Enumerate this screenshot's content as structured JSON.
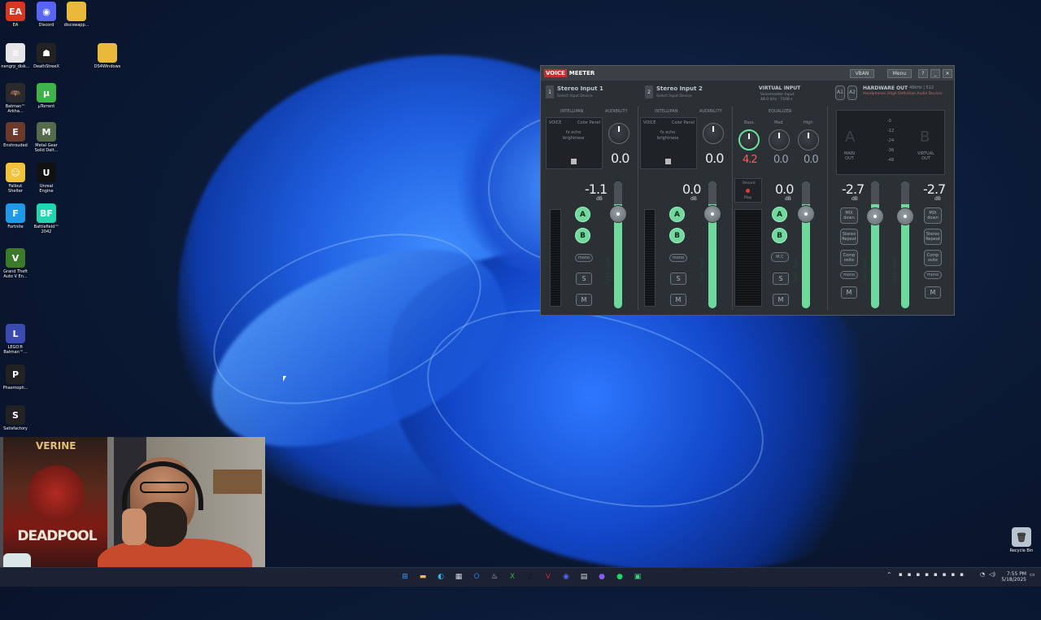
{
  "desktop": {
    "icons": [
      {
        "label": "EA",
        "icon": "ea-icon",
        "color": "#d9361f",
        "glyph": "EA"
      },
      {
        "label": "Discord",
        "icon": "discord-icon",
        "color": "#5865f2",
        "glyph": "◉"
      },
      {
        "label": "discswapp...",
        "icon": "folder-icon",
        "color": "#e8b93a",
        "glyph": ""
      },
      {
        "label": "nengrp_disk...",
        "icon": "file-icon",
        "color": "#e6e6e6",
        "glyph": "≡"
      },
      {
        "label": "DeathStreeX",
        "icon": "game-icon",
        "color": "#222",
        "glyph": "☗"
      },
      {
        "label": "DS4Windows",
        "icon": "folder-icon",
        "color": "#e8b93a",
        "glyph": ""
      },
      {
        "label": "Batman™\nArkha...",
        "icon": "game-icon",
        "color": "#2a2a2a",
        "glyph": "🦇"
      },
      {
        "label": "µTorrent",
        "icon": "utorrent-icon",
        "color": "#3db34a",
        "glyph": "µ"
      },
      {
        "label": "Enshrouded",
        "icon": "game-icon",
        "color": "#6b3a2a",
        "glyph": "E"
      },
      {
        "label": "Metal Gear\nSolid Delt...",
        "icon": "game-icon",
        "color": "#556b4a",
        "glyph": "M"
      },
      {
        "label": "Fallout\nShelter",
        "icon": "game-icon",
        "color": "#f2c23a",
        "glyph": "☺"
      },
      {
        "label": "Unreal\nEngine",
        "icon": "unreal-icon",
        "color": "#111",
        "glyph": "U"
      },
      {
        "label": "Fortnite",
        "icon": "game-icon",
        "color": "#1e9be8",
        "glyph": "F"
      },
      {
        "label": "Battlefield™\n2042",
        "icon": "game-icon",
        "color": "#1fd6b0",
        "glyph": "BF"
      },
      {
        "label": "Grand Theft\nAuto V En...",
        "icon": "game-icon",
        "color": "#3a7a2a",
        "glyph": "V"
      },
      {
        "label": "LEGO®\nBatman™...",
        "icon": "game-icon",
        "color": "#3a4ab0",
        "glyph": "L"
      },
      {
        "label": "Phasmoph...",
        "icon": "game-icon",
        "color": "#222",
        "glyph": "P"
      },
      {
        "label": "Satisfactory",
        "icon": "game-icon",
        "color": "#222",
        "glyph": "S"
      }
    ],
    "recycle_bin_label": "Recycle Bin"
  },
  "voicemeeter": {
    "logo_voice": "VOICE",
    "logo_meeter": "MEETER",
    "vban_label": "VBAN",
    "menu_label": "Menu",
    "help_label": "?",
    "minimize_label": "_",
    "close_label": "✕",
    "strips": [
      {
        "num": "1",
        "name": "Stereo Input 1",
        "sub": "Select Input Device",
        "intellipan": "INTELLIPAN",
        "audibility": "AUDIBILITY",
        "voice": "VOICE",
        "color_panel": "Color Panel",
        "fx_label": "fx echo",
        "brightness": "brightness",
        "knob_value": "0.0",
        "gain": "-1.1",
        "db": "dB",
        "bus_a": "A",
        "bus_b": "B",
        "mono": "mono",
        "solo": "S",
        "mute": "M",
        "fader_label": "Fader Gain"
      },
      {
        "num": "2",
        "name": "Stereo Input 2",
        "sub": "Select Input Device",
        "intellipan": "INTELLIPAN",
        "audibility": "AUDIBILITY",
        "voice": "VOICE",
        "color_panel": "Color Panel",
        "fx_label": "fx echo",
        "brightness": "brightness",
        "knob_value": "0.0",
        "gain": "0.0",
        "db": "dB",
        "bus_a": "A",
        "bus_b": "B",
        "mono": "mono",
        "solo": "S",
        "mute": "M",
        "fader_label": "Fader Gain"
      }
    ],
    "virtual": {
      "title": "VIRTUAL INPUT",
      "sub1": "Voicemeeter Input",
      "sub2": "48.0 kHz - 7168 s",
      "equalizer": "EQUALIZER",
      "bass": "Bass",
      "bass_value": "4.2",
      "med": "Med",
      "med_value": "0.0",
      "high": "High",
      "high_value": "0.0",
      "gain": "0.0",
      "db": "dB",
      "bus_a": "A",
      "bus_b": "B",
      "mc": "M.C",
      "solo": "S",
      "mute": "M",
      "fader_label": "Fader Gain",
      "rec_top": "Record",
      "rec_bottom": "Play"
    },
    "hardware": {
      "a1": "A1",
      "a2": "A2",
      "title": "HARDWARE OUT",
      "rate": "48kHz | 512",
      "device": "Headphones (High Definition Audio Device)",
      "bus_a": "A",
      "bus_b": "B",
      "main_out": "MAIN\nOUT",
      "virtual_out": "VIRTUAL\nOUT",
      "scale": [
        "-0",
        "-12",
        "-24",
        "-36",
        "-48"
      ],
      "gain_a": "-2.7",
      "gain_b": "-2.7",
      "db": "dB",
      "mix_down": "MIX\ndown",
      "stereo_repeat": "Stereo\nRepeat",
      "composite": "Comp\nosite",
      "mono": "mono",
      "mute": "M",
      "fader_label": "Fader Gain"
    }
  },
  "taskbar": {
    "icons": [
      {
        "name": "start-icon",
        "glyph": "⊞",
        "color": "#3a9cff"
      },
      {
        "name": "file-explorer-icon",
        "glyph": "▬",
        "color": "#f0c040"
      },
      {
        "name": "edge-icon",
        "glyph": "◐",
        "color": "#2fb6e8"
      },
      {
        "name": "store-icon",
        "glyph": "▦",
        "color": "#cfd6e0"
      },
      {
        "name": "outlook-icon",
        "glyph": "O",
        "color": "#2a72d8"
      },
      {
        "name": "steam-icon",
        "glyph": "♨",
        "color": "#c7d5e0"
      },
      {
        "name": "xbox-icon",
        "glyph": "X",
        "color": "#3fae49"
      },
      {
        "name": "tiktok-icon",
        "glyph": "♪",
        "color": "#111"
      },
      {
        "name": "voicemeeter-icon",
        "glyph": "V",
        "color": "#c0322b"
      },
      {
        "name": "discord-icon",
        "glyph": "◉",
        "color": "#5865f2"
      },
      {
        "name": "calculator-icon",
        "glyph": "▤",
        "color": "#d8d8d8"
      },
      {
        "name": "obs-icon",
        "glyph": "●",
        "color": "#8a5cf6"
      },
      {
        "name": "spotify-icon",
        "glyph": "●",
        "color": "#1ed760"
      },
      {
        "name": "app-icon",
        "glyph": "▣",
        "color": "#3fd07a"
      }
    ],
    "time": "7:55 PM",
    "date": "5/18/2025"
  }
}
